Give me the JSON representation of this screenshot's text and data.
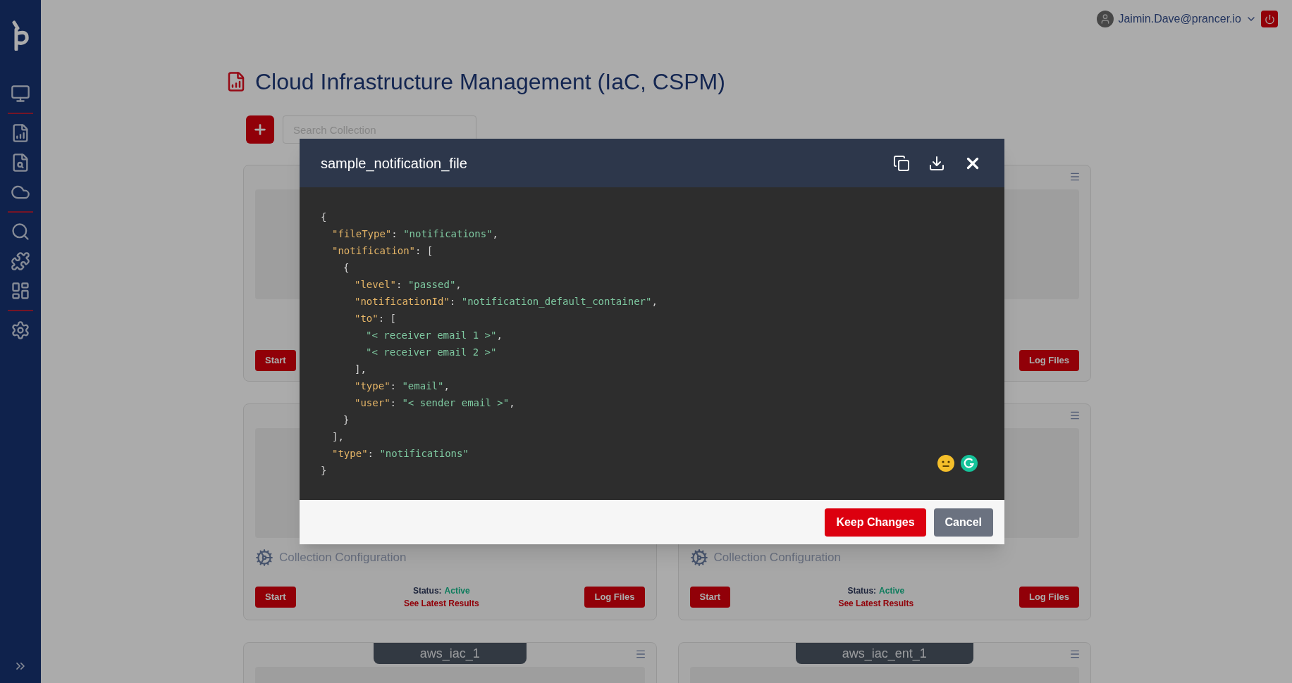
{
  "header": {
    "user": "Jaimin.Dave@prancer.io"
  },
  "page": {
    "title": "Cloud Infrastructure Management (IaC, CSPM)",
    "search": {
      "placeholder": "Search Collection"
    }
  },
  "cards": [
    {
      "start": "Start"
    },
    {
      "log_files": "Log Files"
    },
    {
      "collection": "Collection Configuration",
      "start": "Start",
      "status_label": "Status:",
      "status_value": "Active",
      "results": "See Latest Results",
      "log_files": "Log Files"
    },
    {
      "collection": "Collection Configuration",
      "start": "Start",
      "status_label": "Status:",
      "status_value": "Active",
      "results": "See Latest Results",
      "log_files": "Log Files"
    },
    {
      "tag": "aws_iac_1"
    },
    {
      "tag": "aws_iac_ent_1"
    }
  ],
  "modal": {
    "title": "sample_notification_file",
    "code": [
      {
        "tokens": [
          {
            "kind": "punct",
            "text": "{"
          }
        ],
        "children": [
          {
            "tokens": [
              {
                "kind": "key",
                "text": "\"fileType\""
              },
              {
                "kind": "punct",
                "text": ": "
              },
              {
                "kind": "string",
                "text": "\"notifications\""
              },
              {
                "kind": "punct",
                "text": ","
              }
            ]
          },
          {
            "tokens": [
              {
                "kind": "key",
                "text": "\"notification\""
              },
              {
                "kind": "punct",
                "text": ": ["
              }
            ],
            "children": [
              {
                "tokens": [
                  {
                    "kind": "punct",
                    "text": "{"
                  }
                ],
                "children": [
                  {
                    "tokens": [
                      {
                        "kind": "key",
                        "text": "\"level\""
                      },
                      {
                        "kind": "punct",
                        "text": ": "
                      },
                      {
                        "kind": "string",
                        "text": "\"passed\""
                      },
                      {
                        "kind": "punct",
                        "text": ","
                      }
                    ]
                  },
                  {
                    "tokens": [
                      {
                        "kind": "key",
                        "text": "\"notificationId\""
                      },
                      {
                        "kind": "punct",
                        "text": ": "
                      },
                      {
                        "kind": "string",
                        "text": "\"notification_default_container\""
                      },
                      {
                        "kind": "punct",
                        "text": ","
                      }
                    ]
                  },
                  {
                    "tokens": [
                      {
                        "kind": "key",
                        "text": "\"to\""
                      },
                      {
                        "kind": "punct",
                        "text": ": ["
                      }
                    ],
                    "children": [
                      {
                        "tokens": [
                          {
                            "kind": "string",
                            "text": "\"< receiver email 1 >\""
                          },
                          {
                            "kind": "punct",
                            "text": ","
                          }
                        ]
                      },
                      {
                        "tokens": [
                          {
                            "kind": "string",
                            "text": "\"< receiver email 2 >\""
                          }
                        ]
                      }
                    ]
                  },
                  {
                    "tokens": [
                      {
                        "kind": "punct",
                        "text": "],"
                      }
                    ]
                  },
                  {
                    "tokens": [
                      {
                        "kind": "key",
                        "text": "\"type\""
                      },
                      {
                        "kind": "punct",
                        "text": ": "
                      },
                      {
                        "kind": "string",
                        "text": "\"email\""
                      },
                      {
                        "kind": "punct",
                        "text": ","
                      }
                    ]
                  },
                  {
                    "tokens": [
                      {
                        "kind": "key",
                        "text": "\"user\""
                      },
                      {
                        "kind": "punct",
                        "text": ": "
                      },
                      {
                        "kind": "string",
                        "text": "\"< sender email >\""
                      },
                      {
                        "kind": "punct",
                        "text": ","
                      }
                    ]
                  }
                ]
              },
              {
                "tokens": [
                  {
                    "kind": "punct",
                    "text": "}"
                  }
                ]
              }
            ]
          },
          {
            "tokens": [
              {
                "kind": "punct",
                "text": "],"
              }
            ]
          },
          {
            "tokens": [
              {
                "kind": "key",
                "text": "\"type\""
              },
              {
                "kind": "punct",
                "text": ": "
              },
              {
                "kind": "string",
                "text": "\"notifications\""
              }
            ]
          }
        ]
      },
      {
        "tokens": [
          {
            "kind": "punct",
            "text": "}"
          }
        ]
      }
    ],
    "buttons": [
      {
        "kind": "primary",
        "label": "Keep Changes"
      },
      {
        "kind": "secondary",
        "label": "Cancel"
      }
    ]
  }
}
